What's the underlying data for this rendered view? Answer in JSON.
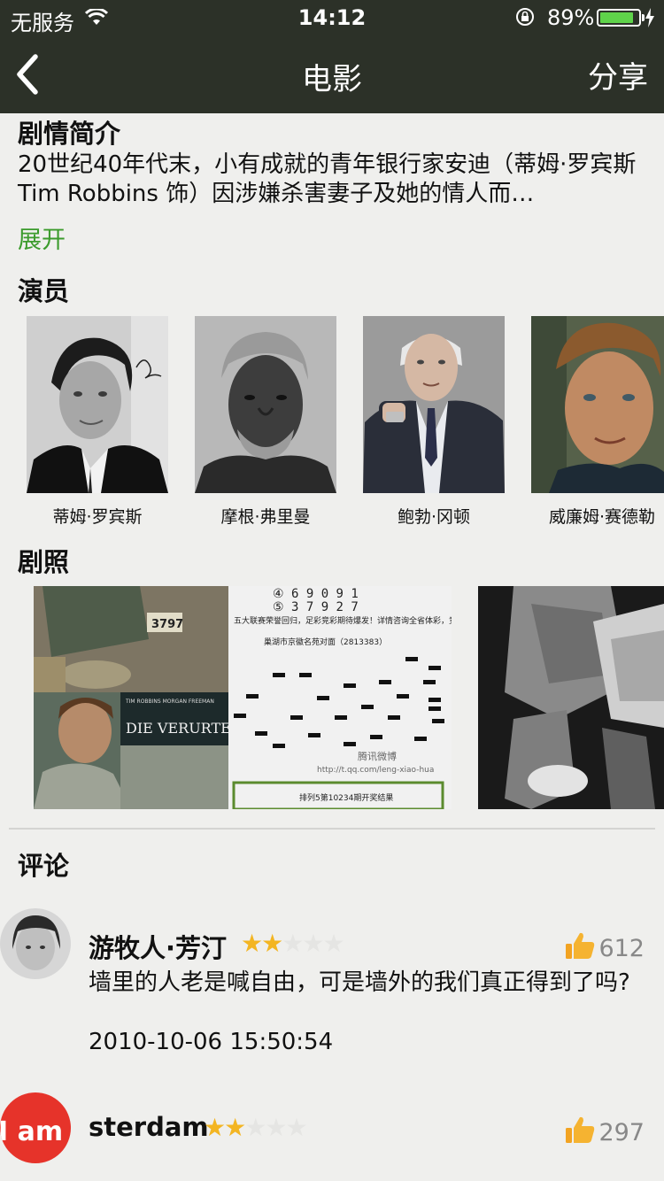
{
  "status_bar": {
    "carrier": "无服务",
    "time": "14:12",
    "battery_percent": "89%",
    "battery_level": 0.89,
    "icons": [
      "wifi-icon",
      "orientation-lock-icon",
      "battery-icon",
      "charging-icon"
    ]
  },
  "nav": {
    "back_icon": "chevron-left-icon",
    "title": "电影",
    "share_label": "分享"
  },
  "synopsis": {
    "title": "剧情简介",
    "text": "20世纪40年代末，小有成就的青年银行家安迪（蒂姆·罗宾斯 Tim Robbins 饰）因涉嫌杀害妻子及她的情人而…",
    "expand_label": "展开"
  },
  "cast": {
    "title": "演员",
    "actors": [
      {
        "name": "蒂姆·罗宾斯"
      },
      {
        "name": "摩根·弗里曼"
      },
      {
        "name": "鲍勃·冈顿"
      },
      {
        "name": "威廉姆·赛德勒"
      }
    ]
  },
  "stills": {
    "title": "剧照",
    "poster_text": "DIE VERURTEILTEN",
    "poster_credits": "TIM ROBBINS  MORGAN FREEMAN",
    "prison_number": "3797",
    "lottery_lines": [
      "④ 6 9 0 9 1",
      "⑤ 3 7 9 2 7"
    ],
    "lottery_caption": "五大联赛荣誉回归，足彩竞彩期待爆发！详情咨询全省体彩，竞彩网点！",
    "lottery_address": "巢湖市京徽名苑对面（2813383）",
    "watermark": "腾讯微博",
    "url": "http://t.qq.com/leng-xiao-hua",
    "footer": "排列5第10234期开奖结果"
  },
  "comments": {
    "title": "评论",
    "items": [
      {
        "user": "游牧人·芳汀",
        "rating": 2,
        "max_rating": 5,
        "likes": "612",
        "text": "墙里的人老是喊自由，可是墙外的我们真正得到了吗?",
        "time": "2010-10-06 15:50:54"
      },
      {
        "user": "sterdam",
        "rating": 2,
        "max_rating": 5,
        "likes": "297",
        "avatar_text": "I am"
      }
    ]
  },
  "colors": {
    "nav_bg": "#2c3128",
    "accent_green": "#3b9b2c",
    "star": "#f3b522",
    "page_bg": "#efefed"
  }
}
